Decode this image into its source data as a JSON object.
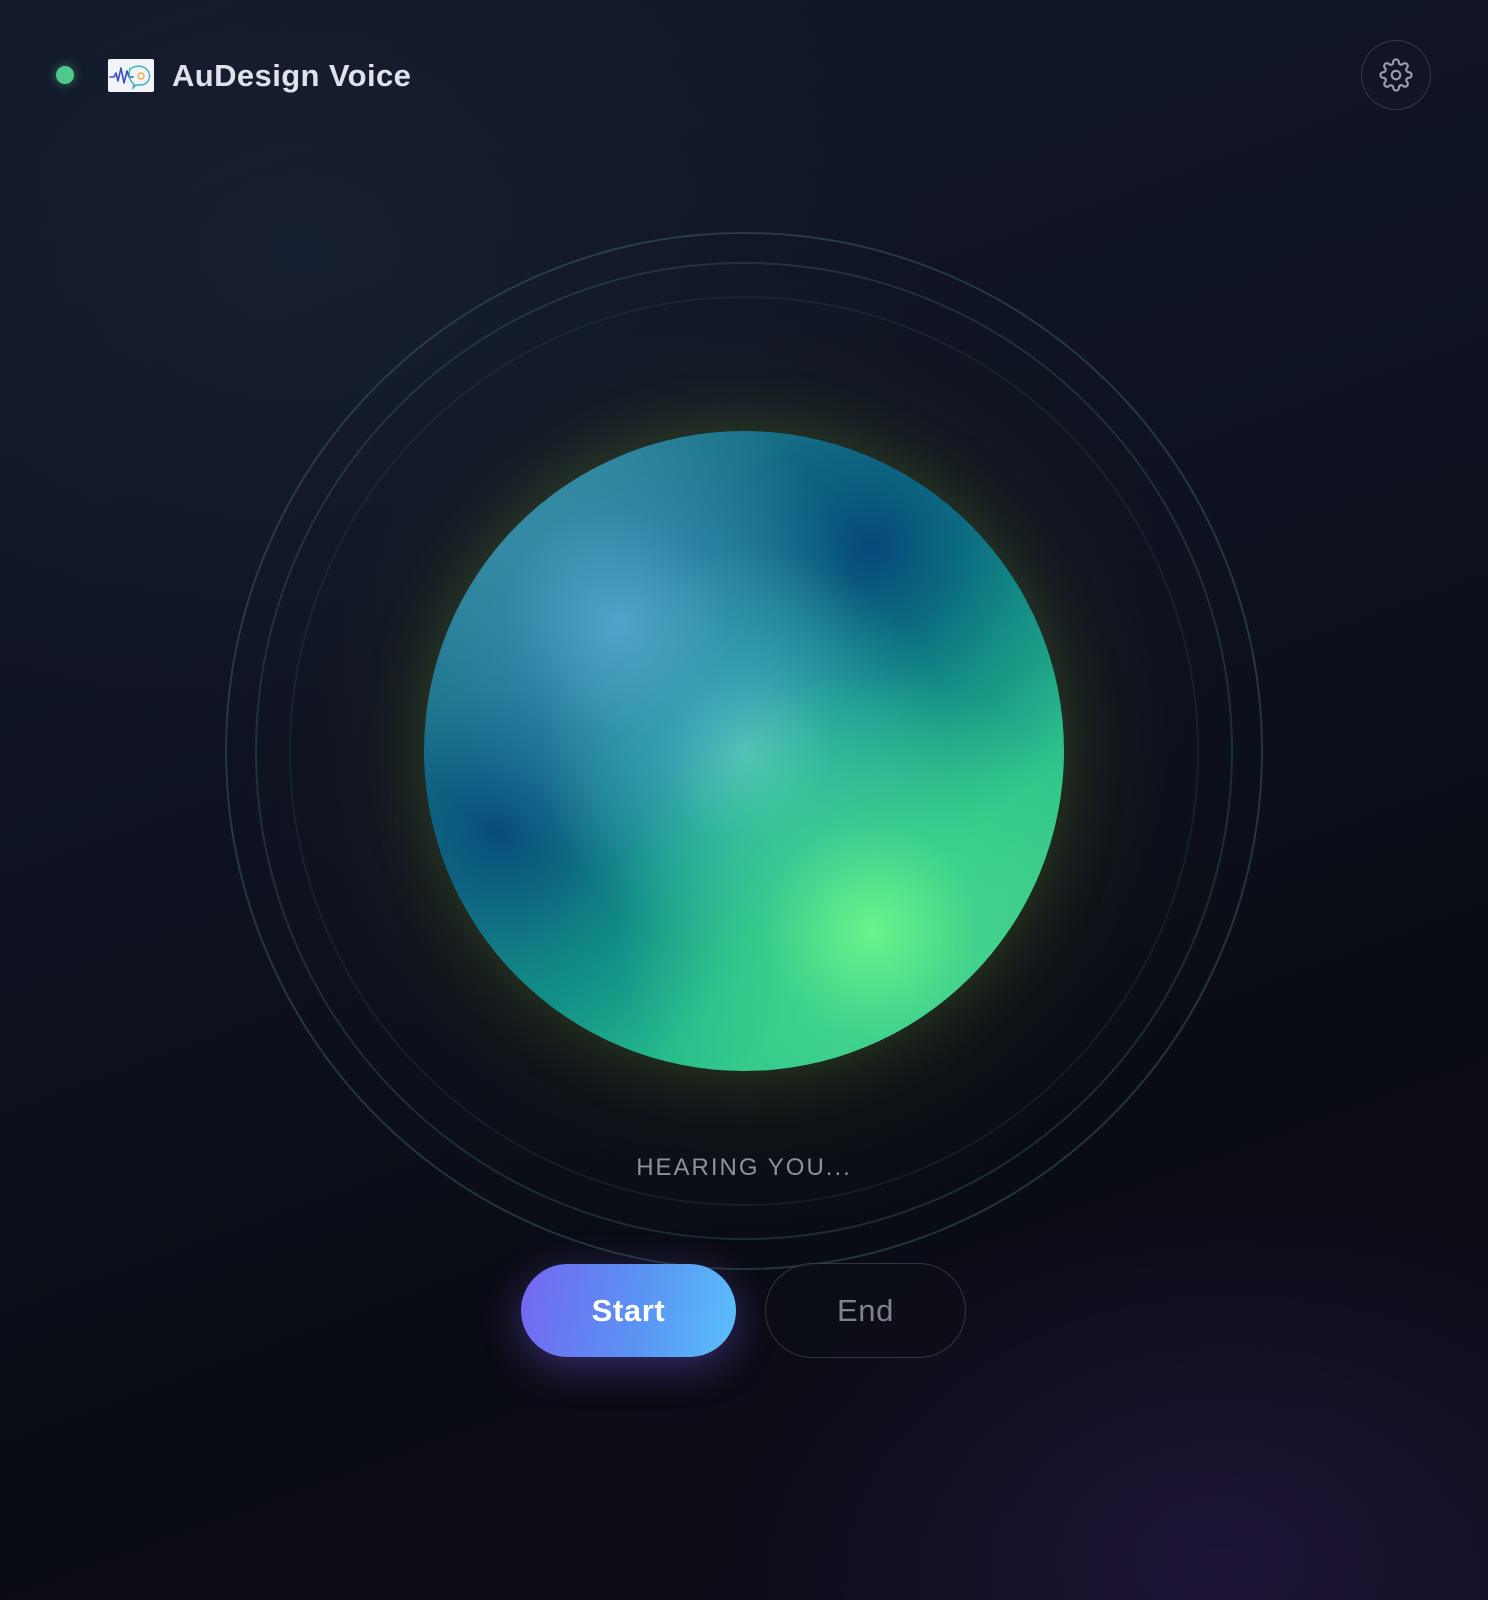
{
  "header": {
    "app_title": "AuDesign Voice",
    "status_dot_color": "#4fc98a",
    "logo_icon": "waveform-chat-logo",
    "settings_icon": "gear-icon"
  },
  "main": {
    "status_text": "HEARING YOU...",
    "orb_colors": [
      "#1d7f92",
      "#14a38e",
      "#6ef58c",
      "#5aaad2"
    ]
  },
  "controls": {
    "start_label": "Start",
    "end_label": "End",
    "start_gradient": [
      "#7467f2",
      "#5ac0fb"
    ]
  }
}
